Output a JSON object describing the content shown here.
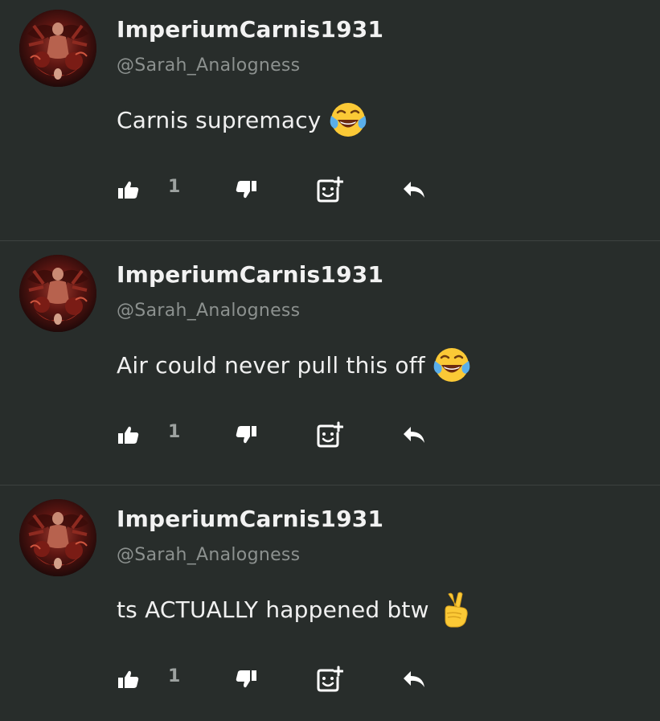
{
  "comments": [
    {
      "display_name": "ImperiumCarnis1931",
      "handle": "@Sarah_Analogness",
      "text": "Carnis supremacy",
      "emoji": "face-with-tears-of-joy",
      "like_count": "1"
    },
    {
      "display_name": "ImperiumCarnis1931",
      "handle": "@Sarah_Analogness",
      "text": "Air could never pull this off",
      "emoji": "face-with-tears-of-joy",
      "like_count": "1"
    },
    {
      "display_name": "ImperiumCarnis1931",
      "handle": "@Sarah_Analogness",
      "text": "ts ACTUALLY happened btw",
      "emoji": "victory-hand",
      "like_count": "1"
    }
  ],
  "colors": {
    "background": "#282d2b",
    "divider": "#3d4240",
    "name": "#f2f2f2",
    "handle": "#8c918f",
    "icon": "#ffffff",
    "count": "#9ea3a1"
  },
  "icons": [
    "thumbs-up-icon",
    "thumbs-down-icon",
    "add-reaction-icon",
    "reply-icon"
  ]
}
